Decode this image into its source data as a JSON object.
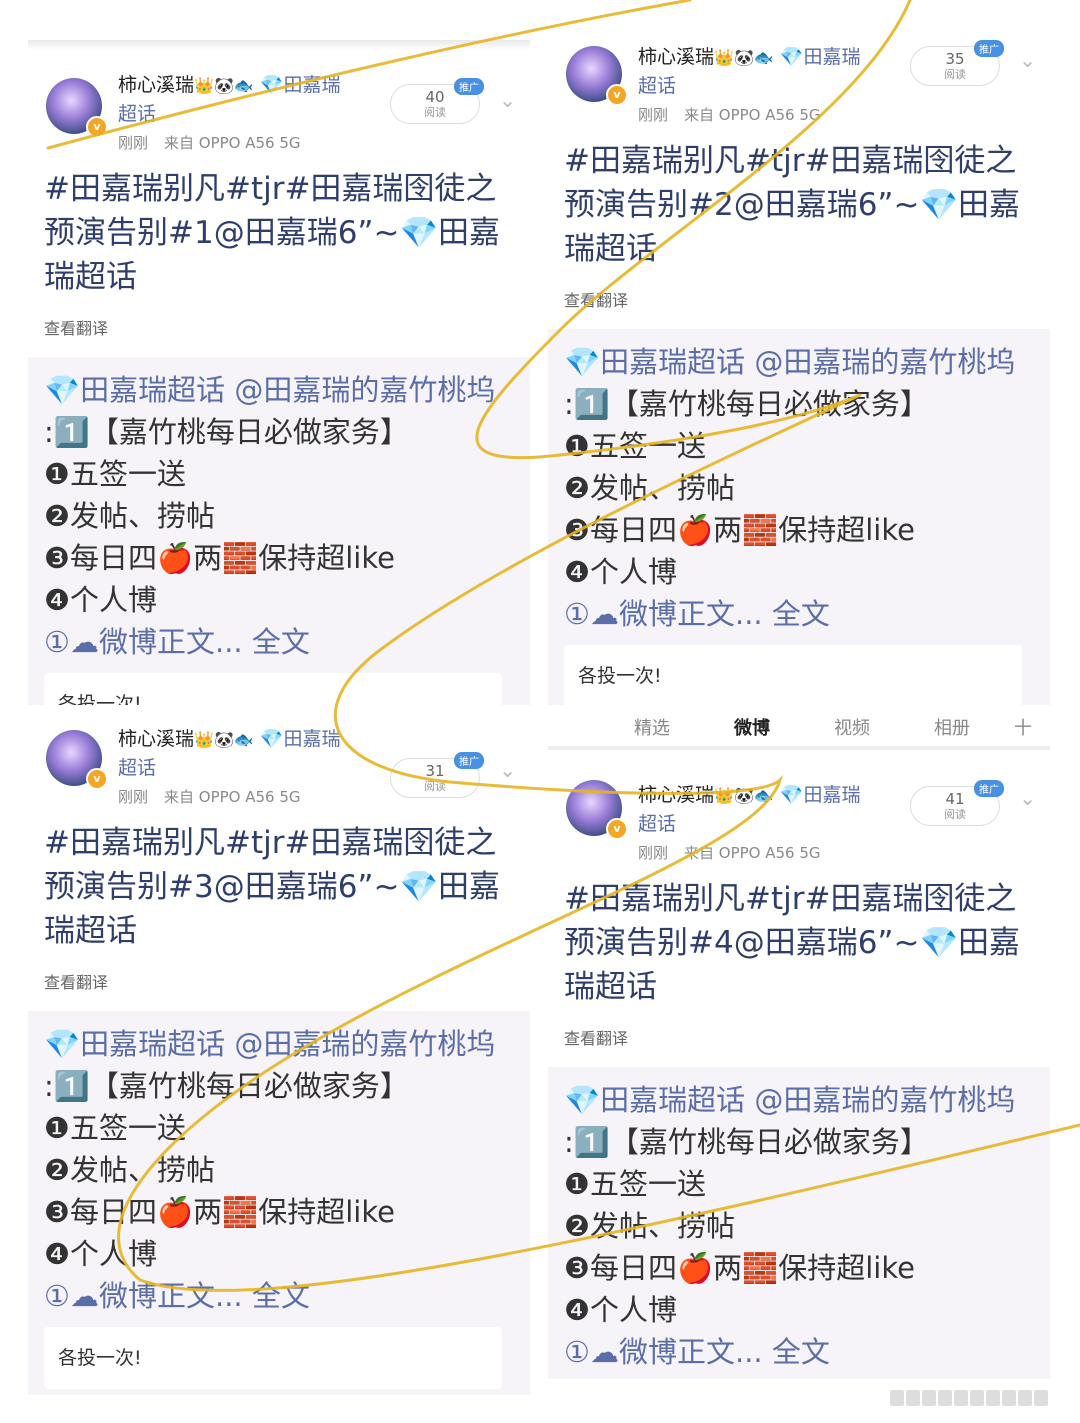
{
  "posts": [
    {
      "user": "柿心溪瑞",
      "emojis": "👑🐼🐟",
      "topic_prefix": "💎",
      "topic1": "田嘉瑞",
      "topic2": "超话",
      "time": "刚刚",
      "source": "来自 OPPO A56 5G",
      "reads": "40",
      "reads_label": "阅读",
      "promo": "推广",
      "content": "#田嘉瑞别凡#tjr#田嘉瑞囹徒之预演告别#1@田嘉瑞6”~💎田嘉瑞超话",
      "translate": "查看翻译",
      "quote_topic": "💎田嘉瑞超话",
      "quote_at": "@田嘉瑞的嘉竹桃坞",
      "quote_line1": ":1️⃣【嘉竹桃每日必做家务】",
      "quote_lines": [
        "❶五签一送",
        "❷发帖、捞帖",
        "❸每日四🍎两🧱保持超like",
        "❹个人博"
      ],
      "quote_more": "①☁微博正文... 全文",
      "comment": "各投一次!"
    },
    {
      "user": "柿心溪瑞",
      "emojis": "👑🐼🐟",
      "topic_prefix": "💎",
      "topic1": "田嘉瑞",
      "topic2": "超话",
      "time": "刚刚",
      "source": "来自 OPPO A56 5G",
      "reads": "35",
      "reads_label": "阅读",
      "promo": "推广",
      "content": "#田嘉瑞别凡#tjr#田嘉瑞囹徒之预演告别#2@田嘉瑞6”~💎田嘉瑞超话",
      "translate": "查看翻译",
      "quote_topic": "💎田嘉瑞超话",
      "quote_at": "@田嘉瑞的嘉竹桃坞",
      "quote_line1": ":1️⃣【嘉竹桃每日必做家务】",
      "quote_lines": [
        "❶五签一送",
        "❷发帖、捞帖",
        "❸每日四🍎两🧱保持超like",
        "❹个人博"
      ],
      "quote_more": "①☁微博正文... 全文",
      "comment": "各投一次!"
    },
    {
      "user": "柿心溪瑞",
      "emojis": "👑🐼🐟",
      "topic_prefix": "💎",
      "topic1": "田嘉瑞",
      "topic2": "超话",
      "time": "刚刚",
      "source": "来自 OPPO A56 5G",
      "reads": "31",
      "reads_label": "阅读",
      "promo": "推广",
      "content": "#田嘉瑞别凡#tjr#田嘉瑞囹徒之预演告别#3@田嘉瑞6”~💎田嘉瑞超话",
      "translate": "查看翻译",
      "quote_topic": "💎田嘉瑞超话",
      "quote_at": "@田嘉瑞的嘉竹桃坞",
      "quote_line1": ":1️⃣【嘉竹桃每日必做家务】",
      "quote_lines": [
        "❶五签一送",
        "❷发帖、捞帖",
        "❸每日四🍎两🧱保持超like",
        "❹个人博"
      ],
      "quote_more": "①☁微博正文... 全文",
      "comment": "各投一次!"
    },
    {
      "user": "柿心溪瑞",
      "emojis": "👑🐼🐟",
      "topic_prefix": "💎",
      "topic1": "田嘉瑞",
      "topic2": "超话",
      "time": "刚刚",
      "source": "来自 OPPO A56 5G",
      "reads": "41",
      "reads_label": "阅读",
      "promo": "推广",
      "content": "#田嘉瑞别凡#tjr#田嘉瑞囹徒之预演告别#4@田嘉瑞6”~💎田嘉瑞超话",
      "translate": "查看翻译",
      "quote_topic": "💎田嘉瑞超话",
      "quote_at": "@田嘉瑞的嘉竹桃坞",
      "quote_line1": ":1️⃣【嘉竹桃每日必做家务】",
      "quote_lines": [
        "❶五签一送",
        "❷发帖、捞帖",
        "❸每日四🍎两🧱保持超like",
        "❹个人博"
      ],
      "quote_more": "①☁微博正文... 全文",
      "comment": ""
    }
  ],
  "tabs": [
    "精选",
    "微博",
    "视频",
    "相册"
  ],
  "tab_active": "微博",
  "tab_plus": "十",
  "colors": {
    "link": "#5b6ea8",
    "scribble": "#e6b422"
  }
}
